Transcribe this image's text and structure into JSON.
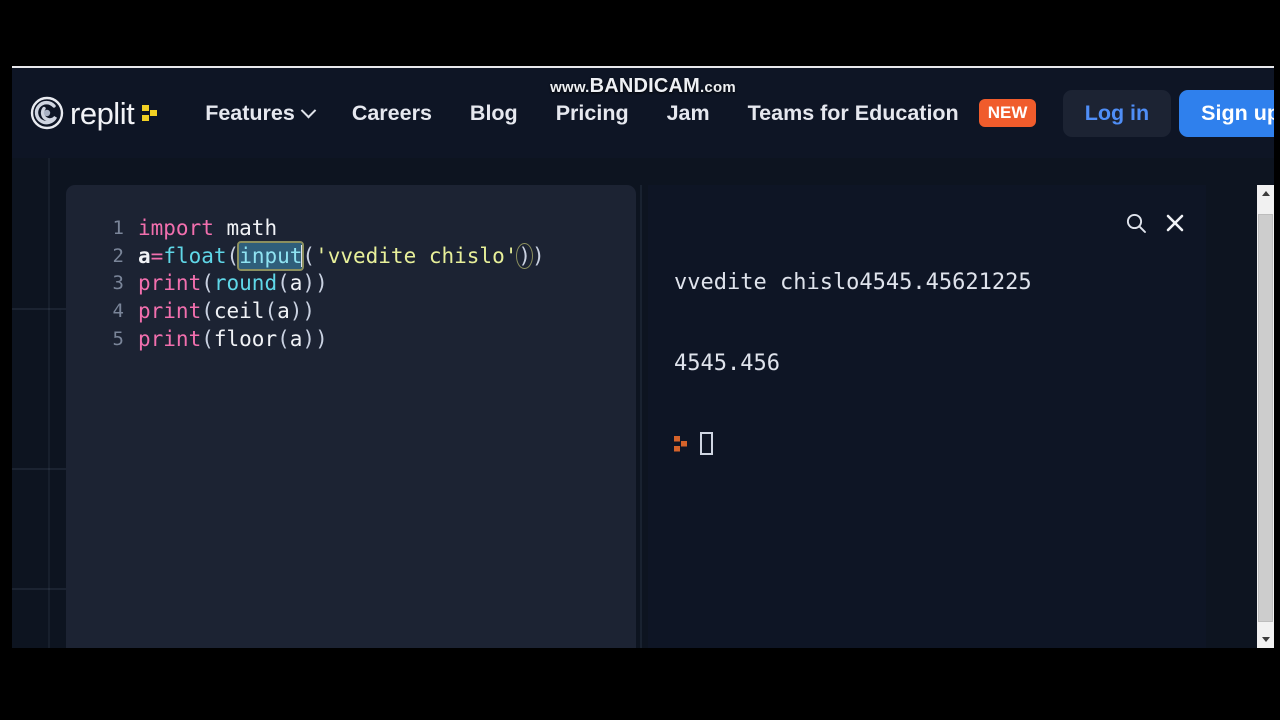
{
  "watermark": {
    "prefix": "www.",
    "brand": "BANDICAM",
    "suffix": ".com"
  },
  "navbar": {
    "logo_text": "replit",
    "logo_icon": "replit-spiral-logo-icon",
    "logo_caret_icon": "replit-cursor-mark-icon",
    "links": [
      {
        "label": "Features",
        "has_chevron": true,
        "chevron_icon": "chevron-down-icon"
      },
      {
        "label": "Careers",
        "has_chevron": false
      },
      {
        "label": "Blog",
        "has_chevron": false
      },
      {
        "label": "Pricing",
        "has_chevron": false
      },
      {
        "label": "Jam",
        "has_chevron": false
      },
      {
        "label": "Teams for Education",
        "has_chevron": false,
        "badge": "NEW"
      }
    ],
    "login_label": "Log in",
    "signup_label": "Sign up",
    "colors": {
      "bar_bg": "#0e1525",
      "badge_new": "#f05c2c",
      "login_text": "#4f8ef7",
      "login_bg": "#1c2333",
      "signup_bg": "#2f80ed"
    }
  },
  "editor": {
    "language": "python",
    "pane_bg": "#1c2333",
    "lines": [
      {
        "number": "1",
        "text": "import math"
      },
      {
        "number": "2",
        "text": "a=float(input('vvedite chislo'))"
      },
      {
        "number": "3",
        "text": "print(round(a))"
      },
      {
        "number": "4",
        "text": "print(ceil(a))"
      },
      {
        "number": "5",
        "text": "print(floor(a))"
      }
    ],
    "tokens": {
      "line1": {
        "kw": "import",
        "space": " ",
        "mod": "math"
      },
      "line2": {
        "var": "a",
        "op": "=",
        "fn1": "float",
        "open1": "(",
        "selected": "input",
        "open2": "(",
        "str": "'vvedite chislo'",
        "close1": ")",
        "close2": ")"
      },
      "line3": {
        "kw": "print",
        "open": "(",
        "fn": "round",
        "inner_open": "(",
        "arg": "a",
        "inner_close": ")",
        "close": ")"
      },
      "line4": {
        "kw": "print",
        "open": "(",
        "fn": "ceil",
        "inner_open": "(",
        "arg": "a",
        "inner_close": ")",
        "close": ")"
      },
      "line5": {
        "kw": "print",
        "open": "(",
        "fn": "floor",
        "inner_open": "(",
        "arg": "a",
        "inner_close": ")",
        "close": ")"
      }
    },
    "selection": "input",
    "colors": {
      "keyword": "#f26fae",
      "function": "#5fd7e8",
      "string": "#e8f09a",
      "text": "#f0f2f6",
      "linenumber": "#7a8599",
      "selection_bg": "#2f5e7a"
    }
  },
  "console": {
    "pane_bg": "#0e1525",
    "output_line_1": "vvedite chislo4545.45621225",
    "output_line_2": "4545.456",
    "prompt_glyph_icon": "replit-prompt-chevron-icon",
    "cursor_icon": "text-cursor-block",
    "search_icon": "search-icon",
    "close_icon": "close-icon"
  },
  "scrollbar": {
    "up_icon": "scroll-up-arrow-icon",
    "down_icon": "scroll-down-arrow-icon",
    "thumb": "scrollbar-thumb"
  }
}
